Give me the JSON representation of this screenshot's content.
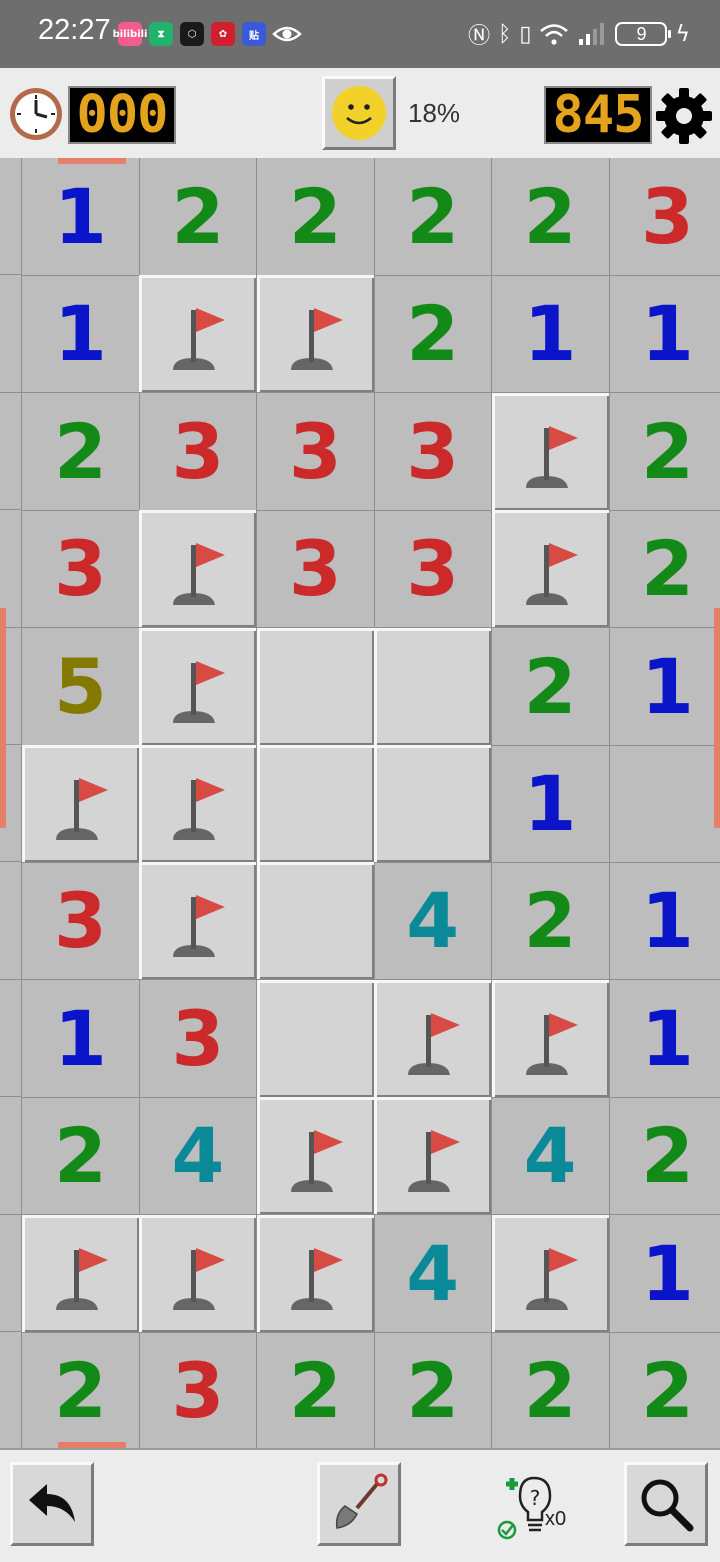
{
  "status_bar": {
    "time": "22:27",
    "notification_icons": [
      {
        "name": "bilibili-icon",
        "text": "bilibili",
        "color": "#f25d8e"
      },
      {
        "name": "hourglass-icon",
        "text": "⧗",
        "color": "#21b36c"
      },
      {
        "name": "app-hexagon-icon",
        "text": "⬡",
        "color": "#1a1a1a"
      },
      {
        "name": "huawei-icon",
        "text": "✿",
        "color": "#d0202e"
      },
      {
        "name": "tieba-icon",
        "text": "贴",
        "color": "#3a5bd9"
      }
    ],
    "battery_level": "9"
  },
  "toolbar": {
    "timer": "000",
    "progress": "18%",
    "mines_remaining": "845"
  },
  "board": {
    "columns": 6,
    "rows": [
      [
        "1",
        "2",
        "2",
        "2",
        "2",
        "3"
      ],
      [
        "1",
        "F",
        "F",
        "2",
        "1",
        "1"
      ],
      [
        "2",
        "3",
        "3",
        "3",
        "F",
        "2"
      ],
      [
        "3",
        "F",
        "3",
        "3",
        "F",
        "2"
      ],
      [
        "5",
        "F",
        "U",
        "U",
        "2",
        "1"
      ],
      [
        "F",
        "F",
        "U",
        "U",
        "1",
        "0"
      ],
      [
        "3",
        "F",
        "U",
        "4",
        "2",
        "1"
      ],
      [
        "1",
        "3",
        "U",
        "F",
        "F",
        "1"
      ],
      [
        "2",
        "4",
        "F",
        "F",
        "4",
        "2"
      ],
      [
        "F",
        "F",
        "F",
        "4",
        "F",
        "1"
      ],
      [
        "2",
        "3",
        "2",
        "2",
        "2",
        "2"
      ]
    ],
    "number_colors": {
      "1": "#0a14c8",
      "2": "#138a17",
      "3": "#cc2a2a",
      "4": "#0a8a99",
      "5": "#857a00"
    },
    "legend": {
      "F": "flag",
      "U": "unrevealed",
      "0": "empty"
    }
  },
  "bottom_bar": {
    "hint_count": "x0",
    "icons": [
      "undo-arrow-icon",
      "shovel-icon",
      "lightbulb-hint-icon",
      "magnifier-icon"
    ]
  }
}
